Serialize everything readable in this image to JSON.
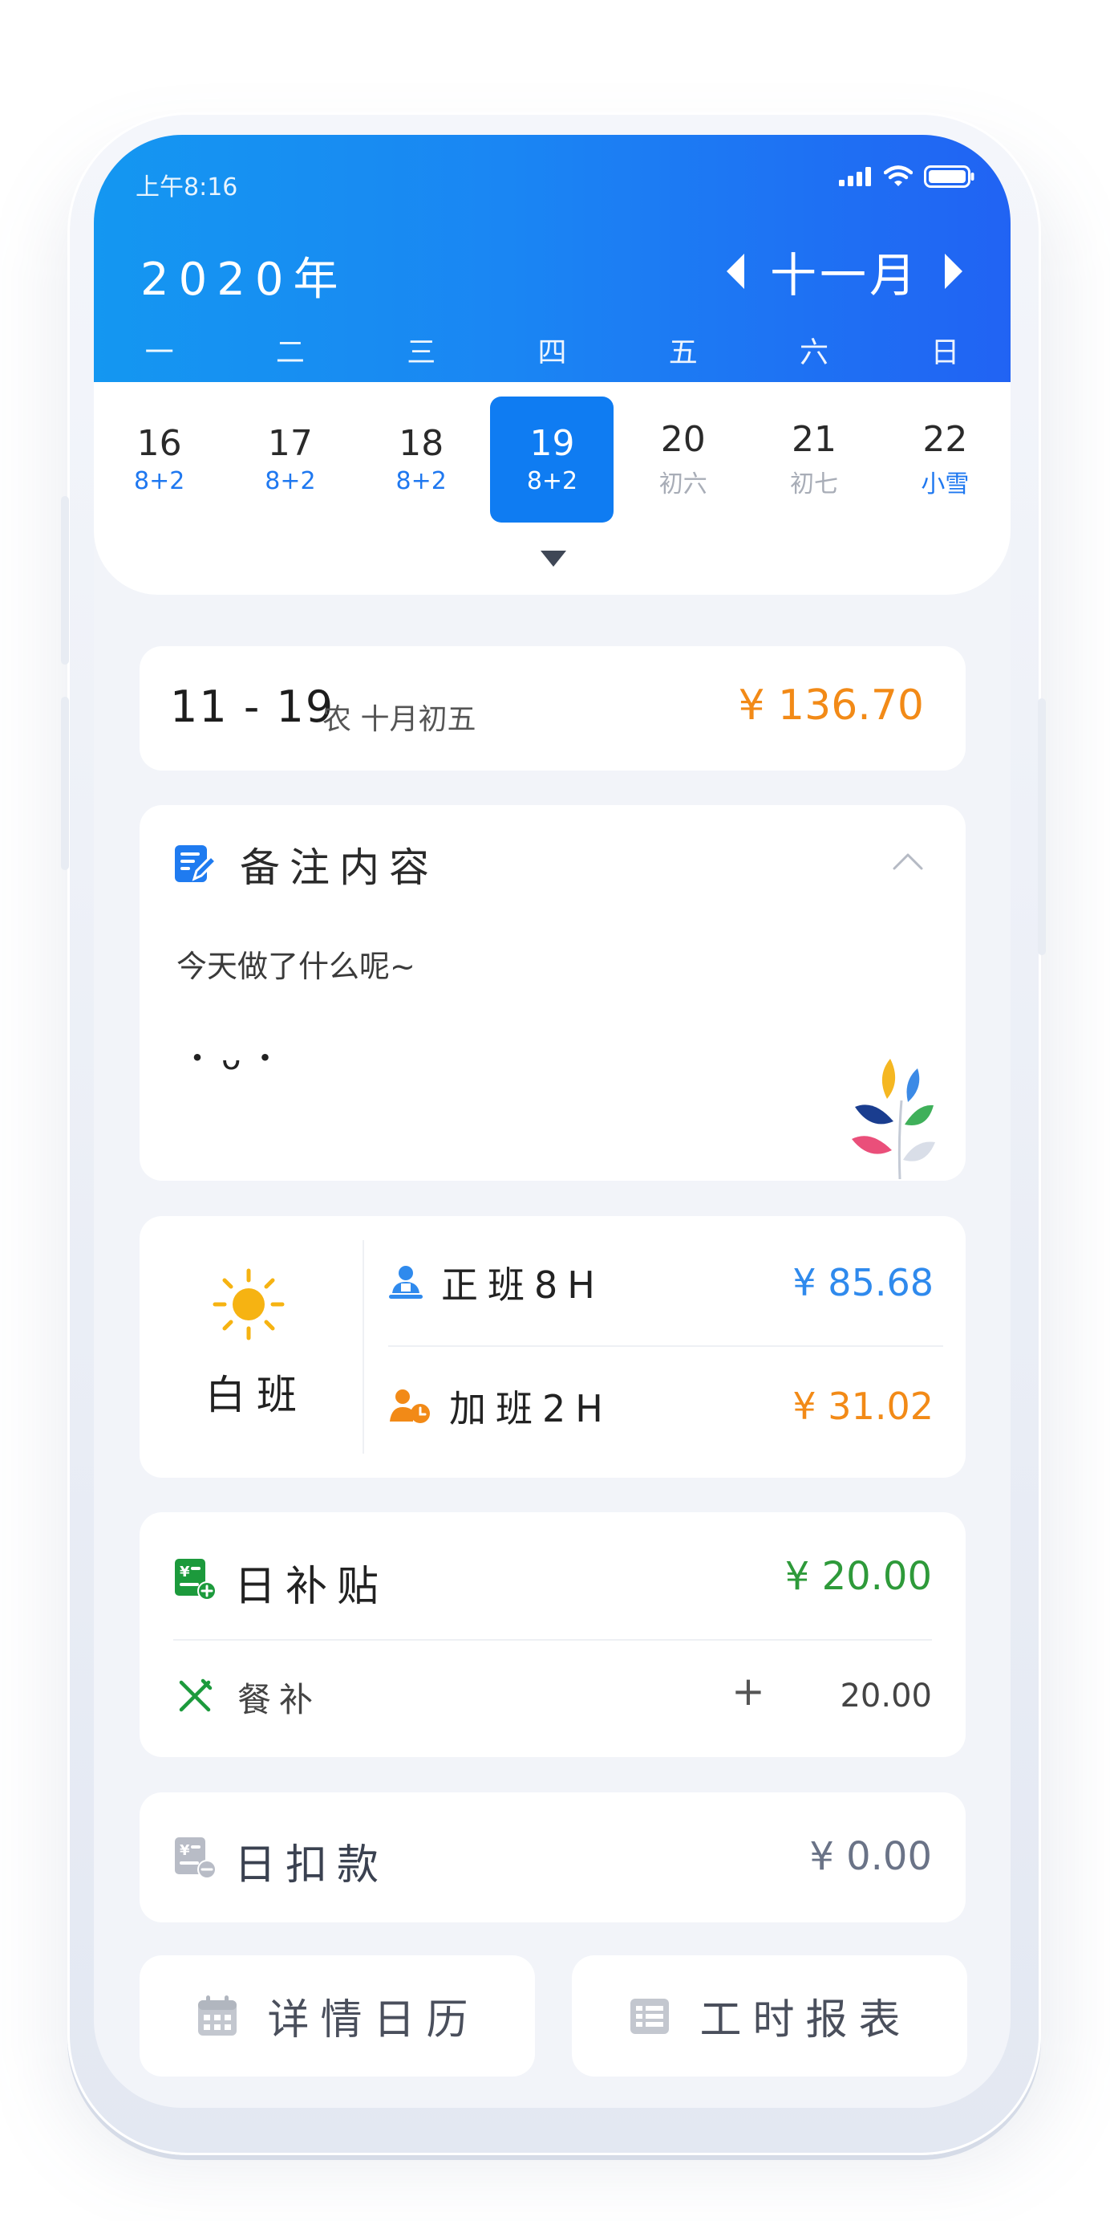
{
  "colors": {
    "header_gradient_start": "#1497f1",
    "header_gradient_end": "#2163f3",
    "selected_day": "#0f7cf2",
    "accent_orange": "#f28a17",
    "accent_blue": "#2f8aed",
    "accent_green": "#2e9a3a",
    "muted_gray": "#6a7387"
  },
  "status_bar": {
    "time": "上午8:16",
    "icons": [
      "signal-icon",
      "wifi-icon",
      "battery-icon"
    ]
  },
  "header": {
    "year": "2020年",
    "month": "十一月",
    "prev_icon": "triangle-left-icon",
    "next_icon": "triangle-right-icon",
    "weekdays": [
      "一",
      "二",
      "三",
      "四",
      "五",
      "六",
      "日"
    ]
  },
  "days": [
    {
      "num": "16",
      "sub": "8+2",
      "sub_type": "shift"
    },
    {
      "num": "17",
      "sub": "8+2",
      "sub_type": "shift"
    },
    {
      "num": "18",
      "sub": "8+2",
      "sub_type": "shift"
    },
    {
      "num": "19",
      "sub": "8+2",
      "sub_type": "shift",
      "selected": true
    },
    {
      "num": "20",
      "sub": "初六",
      "sub_type": "lunar"
    },
    {
      "num": "21",
      "sub": "初七",
      "sub_type": "lunar"
    },
    {
      "num": "22",
      "sub": "小雪",
      "sub_type": "solar-term"
    }
  ],
  "expand_icon": "triangle-down-icon",
  "date_card": {
    "date": "11 - 19",
    "lunar": "农 十月初五",
    "amount": "¥ 136.70"
  },
  "note_card": {
    "title": "备注内容",
    "text": "今天做了什么呢~",
    "emoticon": "・ᴗ・",
    "icon": "note-edit-icon",
    "collapse_icon": "chevron-up-icon",
    "decor_icon": "leaf-branch-icon"
  },
  "shift_card": {
    "icon": "sun-icon",
    "name": "白班",
    "regular": {
      "label": "正班8H",
      "amount": "¥ 85.68",
      "icon": "worker-icon"
    },
    "overtime": {
      "label": "加班2H",
      "amount": "¥ 31.02",
      "icon": "worker-clock-icon"
    }
  },
  "allowance_card": {
    "title": "日补贴",
    "amount": "¥ 20.00",
    "icon": "allowance-plus-icon",
    "item": {
      "label": "餐补",
      "sign": "+",
      "amount": "20.00",
      "icon": "fork-knife-icon"
    }
  },
  "deduction_card": {
    "title": "日扣款",
    "amount": "¥ 0.00",
    "icon": "deduction-minus-icon"
  },
  "buttons": {
    "calendar": {
      "label": "详情日历",
      "icon": "calendar-icon"
    },
    "report": {
      "label": "工时报表",
      "icon": "table-list-icon"
    }
  }
}
